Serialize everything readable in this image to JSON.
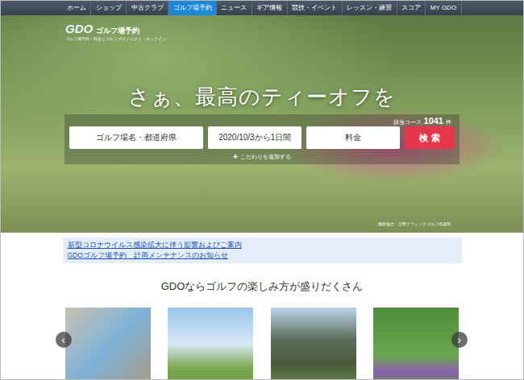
{
  "nav": [
    {
      "label": "ホーム",
      "selected": false
    },
    {
      "label": "ショップ",
      "selected": false
    },
    {
      "label": "中古クラブ",
      "selected": false
    },
    {
      "label": "ゴルフ場予約",
      "selected": true
    },
    {
      "label": "ニュース",
      "selected": false
    },
    {
      "label": "ギア情報",
      "selected": false
    },
    {
      "label": "競技・イベント",
      "selected": false
    },
    {
      "label": "レッスン・練習",
      "selected": false
    },
    {
      "label": "スコア",
      "selected": false
    },
    {
      "label": "MY GDO",
      "selected": false
    }
  ],
  "logo": {
    "mark": "GDO",
    "title": "ゴルフ場予約",
    "tagline": "ゴルフ場予約・料金とゴルフダイジェスト・オンライン"
  },
  "hero": {
    "headline": "さぁ、最高のティーオフを",
    "count_label": "該当コース",
    "count": "1041",
    "count_unit": "件",
    "credit": "撮影協力：立野クラシックゴルフ倶楽部"
  },
  "search": {
    "fields": [
      "ゴルフ場名・都道府県",
      "2020/10/3から1日間",
      "料金"
    ],
    "button": "検 索",
    "more_icon": "+",
    "more": "こだわりを追加する"
  },
  "notices": [
    "新型コロナウイルス感染拡大に伴う影響およびご案内",
    "GDOゴルフ場予約　計画メンテナンスのお知らせ"
  ],
  "section": {
    "title": "GDOならゴルフの楽しみ方が盛りだくさん",
    "prev": "‹",
    "next": "›"
  }
}
